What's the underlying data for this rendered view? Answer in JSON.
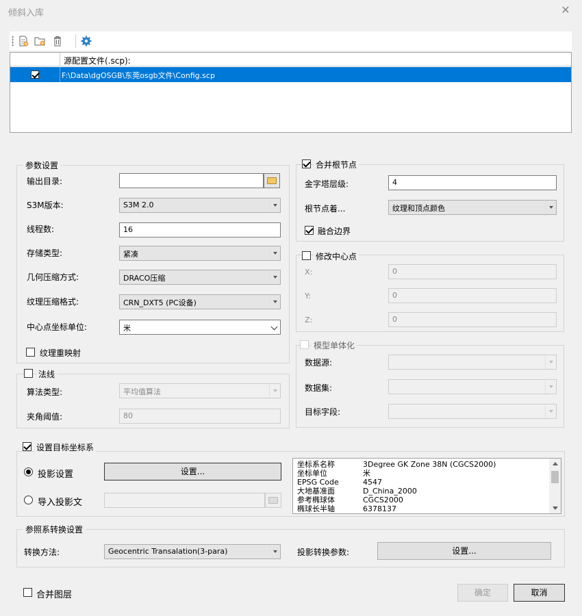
{
  "window": {
    "title": "倾斜入库",
    "close_icon": "✕"
  },
  "toolbar": {
    "icons": [
      "new-file-icon",
      "new-folder-icon",
      "delete-icon",
      "settings-gear-icon"
    ]
  },
  "file_list": {
    "header": "源配置文件(.scp):",
    "rows": [
      {
        "checked": true,
        "path": "F:\\Data\\dgOSGB\\东莞osgb文件\\Config.scp"
      }
    ]
  },
  "params": {
    "legend": "参数设置",
    "output_dir": {
      "label": "输出目录:",
      "value": ""
    },
    "s3m_version": {
      "label": "S3M版本:",
      "value": "S3M 2.0"
    },
    "threads": {
      "label": "线程数:",
      "value": "16"
    },
    "storage_type": {
      "label": "存储类型:",
      "value": "紧凑"
    },
    "geometry_compression": {
      "label": "几何压缩方式:",
      "value": "DRACO压缩"
    },
    "texture_compression": {
      "label": "纹理压缩格式:",
      "value": "CRN_DXT5 (PC设备)"
    },
    "center_unit": {
      "label": "中心点坐标单位:",
      "value": "米"
    },
    "texture_remap": {
      "label": "纹理重映射",
      "checked": false
    }
  },
  "normals": {
    "legend": "法线",
    "checked": false,
    "algorithm": {
      "label": "算法类型:",
      "value": "平均值算法"
    },
    "angle_threshold": {
      "label": "夹角阈值:",
      "value": "80"
    }
  },
  "merge_root": {
    "legend": "合并根节点",
    "checked": true,
    "pyramid_level": {
      "label": "金字塔层级:",
      "value": "4"
    },
    "root_shading": {
      "label": "根节点着...",
      "value": "纹理和顶点颜色"
    },
    "merge_border": {
      "label": "融合边界",
      "checked": true
    }
  },
  "center_point": {
    "legend": "修改中心点",
    "checked": false,
    "x": {
      "label": "X:",
      "value": "0"
    },
    "y": {
      "label": "Y:",
      "value": "0"
    },
    "z": {
      "label": "Z:",
      "value": "0"
    }
  },
  "monomer": {
    "legend": "模型单体化",
    "checked": false,
    "datasource": {
      "label": "数据源:",
      "value": ""
    },
    "dataset": {
      "label": "数据集:",
      "value": ""
    },
    "target_field": {
      "label": "目标字段:",
      "value": ""
    }
  },
  "target_crs": {
    "legend": "设置目标坐标系",
    "checked": true,
    "projection_setting": {
      "label": "投影设置",
      "selected": true,
      "button": "设置..."
    },
    "import_projection": {
      "label": "导入投影文",
      "selected": false,
      "value": ""
    },
    "info": [
      {
        "key": "坐标系名称",
        "value": "3Degree GK Zone 38N    (CGCS2000)"
      },
      {
        "key": "坐标单位",
        "value": "米"
      },
      {
        "key": "EPSG Code",
        "value": "4547"
      },
      {
        "key": "大地基准面",
        "value": "D_China_2000"
      },
      {
        "key": "参考椭球体",
        "value": "CGCS2000"
      },
      {
        "key": "椭球长半轴",
        "value": "6378137"
      }
    ]
  },
  "ref_transform": {
    "legend": "参照系转换设置",
    "method": {
      "label": "转换方法:",
      "value": "Geocentric Transalation(3-para)"
    },
    "params": {
      "label": "投影转换参数:",
      "button": "设置..."
    }
  },
  "footer": {
    "merge_layers": {
      "label": "合并图层",
      "checked": false
    },
    "ok": "确定",
    "cancel": "取消"
  }
}
